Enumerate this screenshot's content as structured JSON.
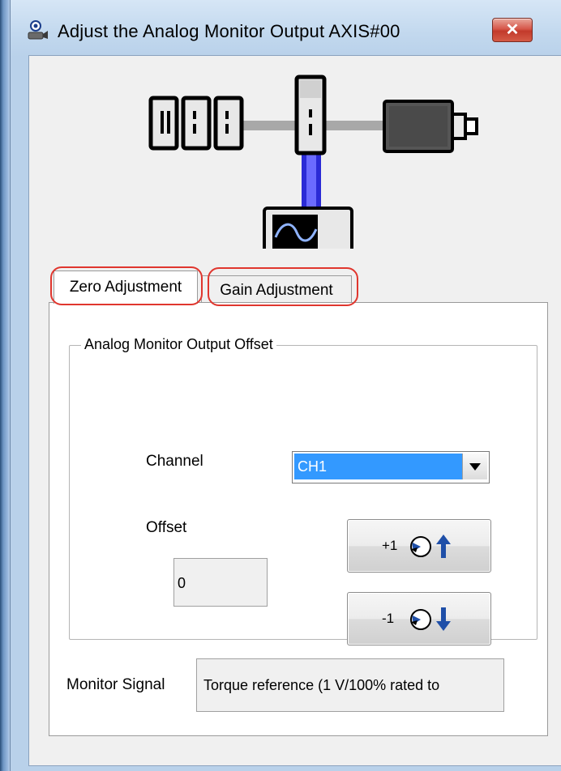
{
  "window": {
    "title": "Adjust the Analog Monitor Output AXIS#00",
    "close_label": "✕",
    "icon": "servo-monitor-icon"
  },
  "diagram": {
    "icon": "servo-system-diagram"
  },
  "tabs": [
    {
      "label": "Zero Adjustment",
      "selected": true,
      "highlighted": true
    },
    {
      "label": "Gain Adjustment",
      "selected": false,
      "highlighted": true
    }
  ],
  "offset_group": {
    "title": "Analog Monitor Output Offset",
    "channel_label": "Channel",
    "channel_value": "CH1",
    "offset_label": "Offset",
    "offset_value": "0",
    "increment_label": "+1",
    "decrement_label": "-1"
  },
  "monitor": {
    "label": "Monitor Signal",
    "value": "Torque reference (1 V/100% rated to"
  },
  "colors": {
    "highlight": "#e0362e",
    "selection": "#3399ff",
    "arrow": "#1f4fa8"
  }
}
